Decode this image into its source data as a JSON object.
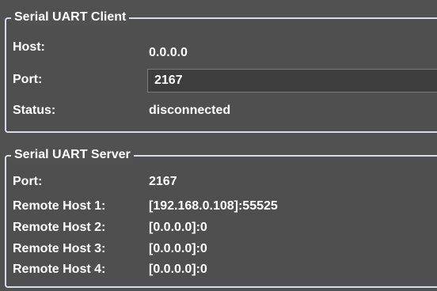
{
  "client": {
    "legend": "Serial UART Client",
    "host_label": "Host:",
    "host_value": "0.0.0.0",
    "port_label": "Port:",
    "port_value": "2167",
    "status_label": "Status:",
    "status_value": "disconnected"
  },
  "server": {
    "legend": "Serial UART Server",
    "rows": [
      {
        "label": "Port:",
        "value": "2167"
      },
      {
        "label": "Remote Host 1:",
        "value": "[192.168.0.108]:55525"
      },
      {
        "label": "Remote Host 2:",
        "value": "[0.0.0.0]:0"
      },
      {
        "label": "Remote Host 3:",
        "value": "[0.0.0.0]:0"
      },
      {
        "label": "Remote Host 4:",
        "value": "[0.0.0.0]:0"
      }
    ]
  }
}
